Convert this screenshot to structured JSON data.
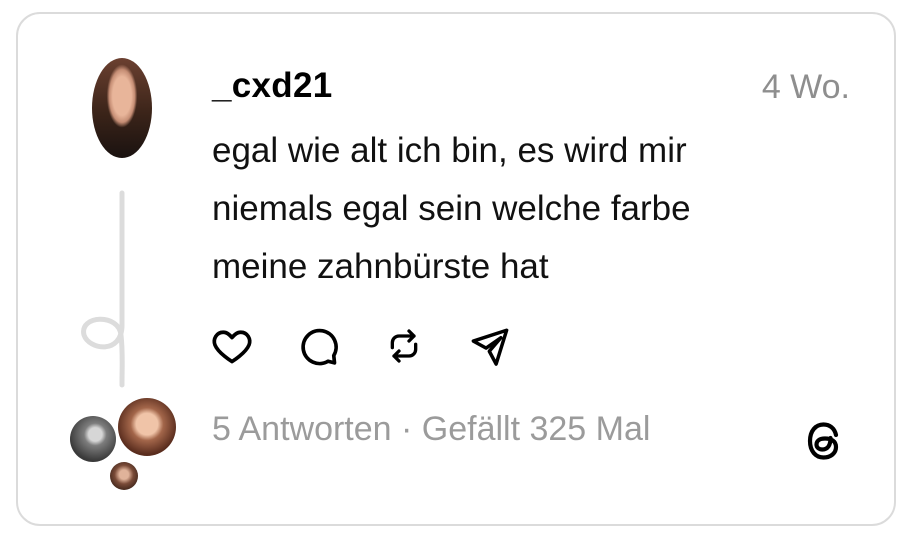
{
  "post": {
    "username": "_cxd21",
    "timestamp": "4 Wo.",
    "text_lines": [
      "egal wie alt ich bin, es wird mir",
      "niemals egal sein welche farbe",
      "meine zahnbürste hat"
    ]
  },
  "actions": [
    {
      "name": "heart-icon",
      "label": "like"
    },
    {
      "name": "comment-icon",
      "label": "reply"
    },
    {
      "name": "repost-icon",
      "label": "repost"
    },
    {
      "name": "share-icon",
      "label": "share"
    }
  ],
  "meta": {
    "replies": "5 Antworten",
    "separator": " · ",
    "likes": "Gefällt 325 Mal"
  },
  "colors": {
    "border": "#dbdbdb",
    "muted": "#8e8e8e",
    "text": "#111111"
  }
}
